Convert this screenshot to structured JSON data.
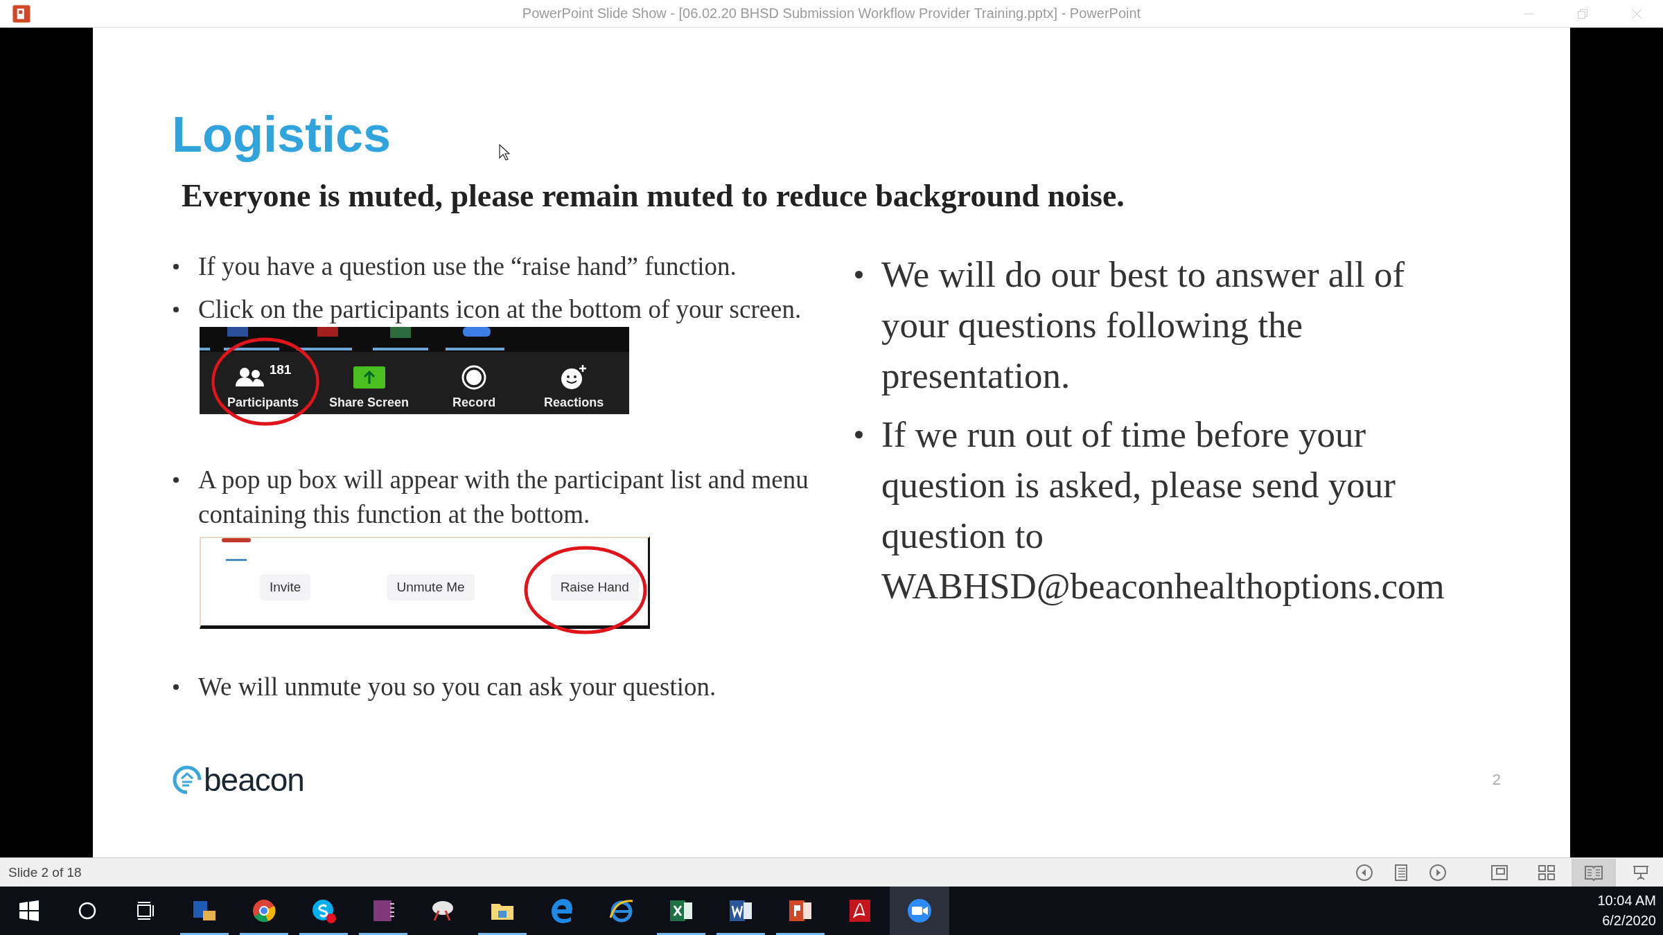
{
  "window": {
    "title": "PowerPoint Slide Show - [06.02.20 BHSD Submission Workflow Provider Training.pptx] - PowerPoint"
  },
  "slide": {
    "title": "Logistics",
    "subtitle": "Everyone is muted, please remain muted to reduce background noise.",
    "left_blocks": [
      {
        "kind": "bullet",
        "text": "If you have a question use the “raise hand” function."
      },
      {
        "kind": "bullet",
        "text": "Click on the participants icon at the bottom of your screen."
      },
      {
        "kind": "toolbar",
        "buttons": [
          {
            "kind": "participants",
            "label": "Participants",
            "count": "181",
            "circled": true
          },
          {
            "kind": "share",
            "label": "Share Screen",
            "circled": false
          },
          {
            "kind": "record",
            "label": "Record",
            "circled": false
          },
          {
            "kind": "reactions",
            "label": "Reactions",
            "circled": false
          }
        ]
      },
      {
        "kind": "bullet",
        "text": "A pop up box will appear with the participant list and menu containing this function at the bottom."
      },
      {
        "kind": "popup",
        "buttons": [
          {
            "label": "Invite",
            "circled": false
          },
          {
            "label": "Unmute Me",
            "circled": false
          },
          {
            "label": "Raise Hand",
            "circled": true
          }
        ]
      },
      {
        "kind": "bullet",
        "text": "We will unmute you so you can ask your question."
      }
    ],
    "right_bullets": [
      "We will do our best to answer all of your questions following the presentation.",
      "If we run out of time before your question is asked, please send your question to WABHSD@beaconhealthoptions.com"
    ],
    "logo": "beacon",
    "page_number": "2"
  },
  "status_bar": {
    "slide_indicator": "Slide 2 of 18",
    "views": [
      {
        "kind": "normal",
        "selected": false
      },
      {
        "kind": "sorter",
        "selected": false
      },
      {
        "kind": "reading",
        "selected": true
      },
      {
        "kind": "show",
        "selected": false
      }
    ]
  },
  "taskbar": {
    "apps": [
      {
        "kind": "outlook",
        "running": true,
        "active": false
      },
      {
        "kind": "chrome",
        "running": true,
        "active": false
      },
      {
        "kind": "skype",
        "running": true,
        "active": false
      },
      {
        "kind": "onenote",
        "running": true,
        "active": false
      },
      {
        "kind": "snipping",
        "running": false,
        "active": false
      },
      {
        "kind": "explorer",
        "running": true,
        "active": false
      },
      {
        "kind": "edge",
        "running": false,
        "active": false
      },
      {
        "kind": "ie",
        "running": false,
        "active": false
      },
      {
        "kind": "excel",
        "running": true,
        "active": false
      },
      {
        "kind": "word",
        "running": true,
        "active": false
      },
      {
        "kind": "powerpoint",
        "running": true,
        "active": false
      },
      {
        "kind": "acrobat",
        "running": false,
        "active": false
      },
      {
        "kind": "zoom",
        "running": false,
        "active": true
      }
    ],
    "time": "10:04 AM",
    "date": "6/2/2020"
  }
}
